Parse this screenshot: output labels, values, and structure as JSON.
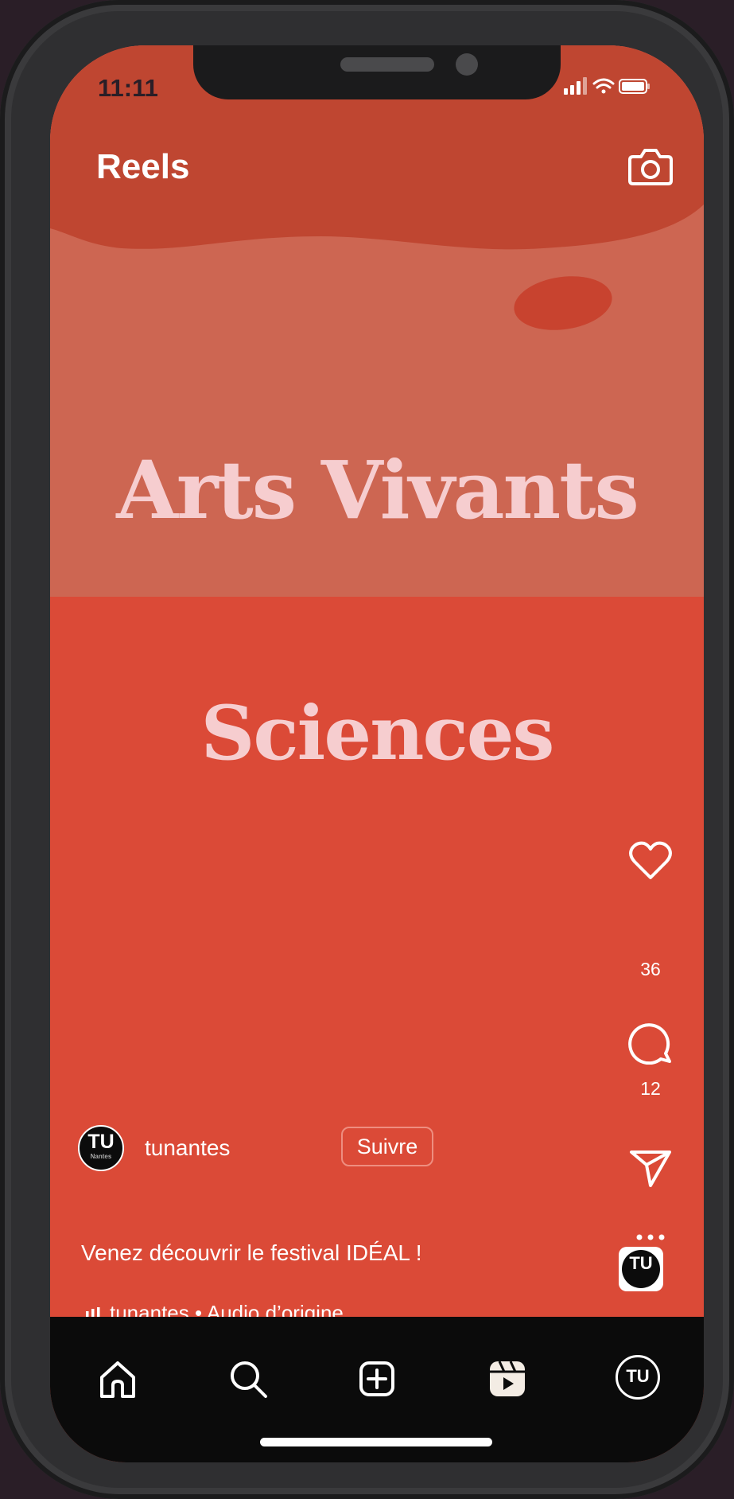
{
  "status_bar": {
    "time": "11:11"
  },
  "header": {
    "title": "Reels",
    "camera_icon": "camera-icon"
  },
  "reel": {
    "headline_1": "Arts Vivants",
    "headline_2": "Sciences",
    "likes": "36",
    "comments": "12",
    "owner": {
      "avatar_text": "TU",
      "avatar_subtext": "Nantes",
      "username": "tunantes",
      "follow_label": "Suivre"
    },
    "caption": "Venez découvrir le festival IDÉAL !",
    "audio": "tunantes • Audio d’origine",
    "audio_thumb_text": "TU"
  },
  "tabbar": {
    "items": [
      "home-icon",
      "search-icon",
      "create-icon",
      "reels-icon",
      "profile-avatar"
    ],
    "profile_text": "TU"
  },
  "colors": {
    "accent_red": "#db4a37",
    "top_band": "#bf4631",
    "headline_pink": "#f6cdcf",
    "tabbar_bg": "#0b0b0b"
  }
}
